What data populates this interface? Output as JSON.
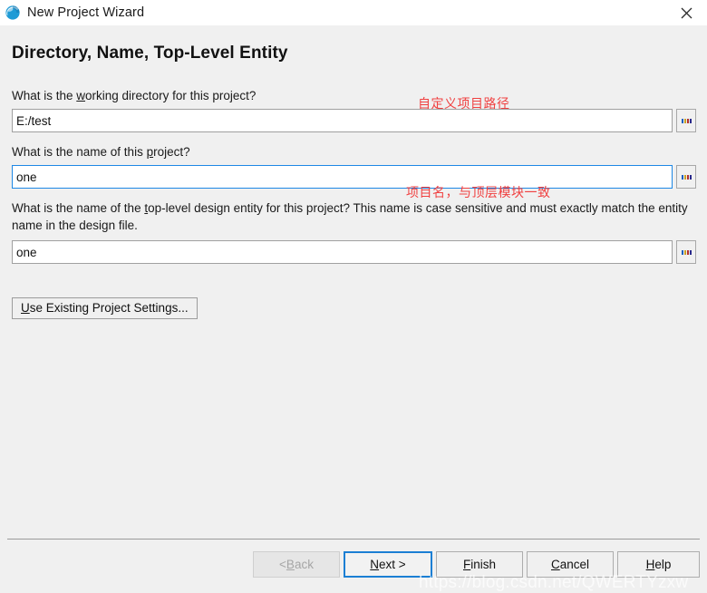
{
  "window": {
    "title": "New Project Wizard",
    "icon": "quartus-sphere-icon",
    "close_label": "✕"
  },
  "page": {
    "heading": "Directory, Name, Top-Level Entity"
  },
  "questions": {
    "working_directory": {
      "prefix": "What is the ",
      "mnemonic": "w",
      "suffix": "orking directory for this project?"
    },
    "project_name": {
      "prefix": "What is the name of this ",
      "mnemonic": "p",
      "suffix": "roject?"
    },
    "top_level_entity": {
      "prefix": "What is the name of the ",
      "mnemonic": "t",
      "suffix": "op-level design entity for this project? This name is case sensitive and must exactly match the entity name in the design file."
    }
  },
  "fields": {
    "working_directory": {
      "value": "E:/test",
      "placeholder": "",
      "focused": false,
      "browse_label": "..."
    },
    "project_name": {
      "value": "one",
      "placeholder": "",
      "focused": true,
      "browse_label": "..."
    },
    "top_level_entity": {
      "value": "one",
      "placeholder": "",
      "focused": false,
      "browse_label": "..."
    }
  },
  "buttons": {
    "use_existing": {
      "mnemonic": "U",
      "rest": "se Existing Project Settings..."
    },
    "back": {
      "prefix": "< ",
      "mnemonic": "B",
      "suffix": "ack",
      "disabled": true
    },
    "next": {
      "prefix": "",
      "mnemonic": "N",
      "suffix": "ext >",
      "default": true
    },
    "finish": {
      "prefix": "",
      "mnemonic": "F",
      "suffix": "inish"
    },
    "cancel": {
      "prefix": "",
      "mnemonic": "C",
      "suffix": "ancel"
    },
    "help": {
      "prefix": "",
      "mnemonic": "H",
      "suffix": "elp"
    }
  },
  "annotations": {
    "working_directory": "自定义项目路径",
    "project_name": "项目名，与顶层模块一致"
  },
  "watermark": "https://blog.csdn.net/QWERTYzxw",
  "colors": {
    "accent": "#1b7fd4",
    "annotation": "#f04040",
    "panel": "#f0f0f0",
    "field_border": "#a0a0a0"
  }
}
